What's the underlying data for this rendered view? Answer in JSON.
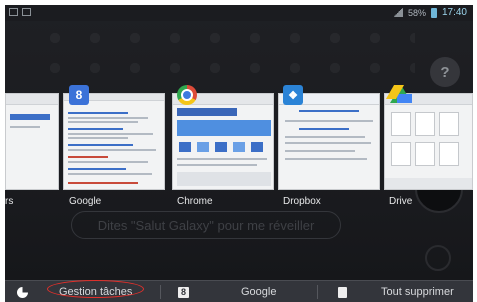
{
  "status_bar": {
    "time": "17:40",
    "battery": "58%"
  },
  "background": {
    "voice_hint": "Dites \"Salut Galaxy\" pour me réveiller",
    "help_icon": "?"
  },
  "recent_apps": [
    {
      "label": "rs",
      "icon": "settings-icon"
    },
    {
      "label": "Google",
      "icon": "google-icon"
    },
    {
      "label": "Chrome",
      "icon": "chrome-icon"
    },
    {
      "label": "Dropbox",
      "icon": "dropbox-icon"
    },
    {
      "label": "Drive",
      "icon": "drive-icon"
    }
  ],
  "bottom_bar": {
    "task_manager": "Gestion tâches",
    "google": "Google",
    "clear_all": "Tout supprimer"
  },
  "colors": {
    "highlight_oval": "#e0302b",
    "bar_bg": "#33353b"
  }
}
